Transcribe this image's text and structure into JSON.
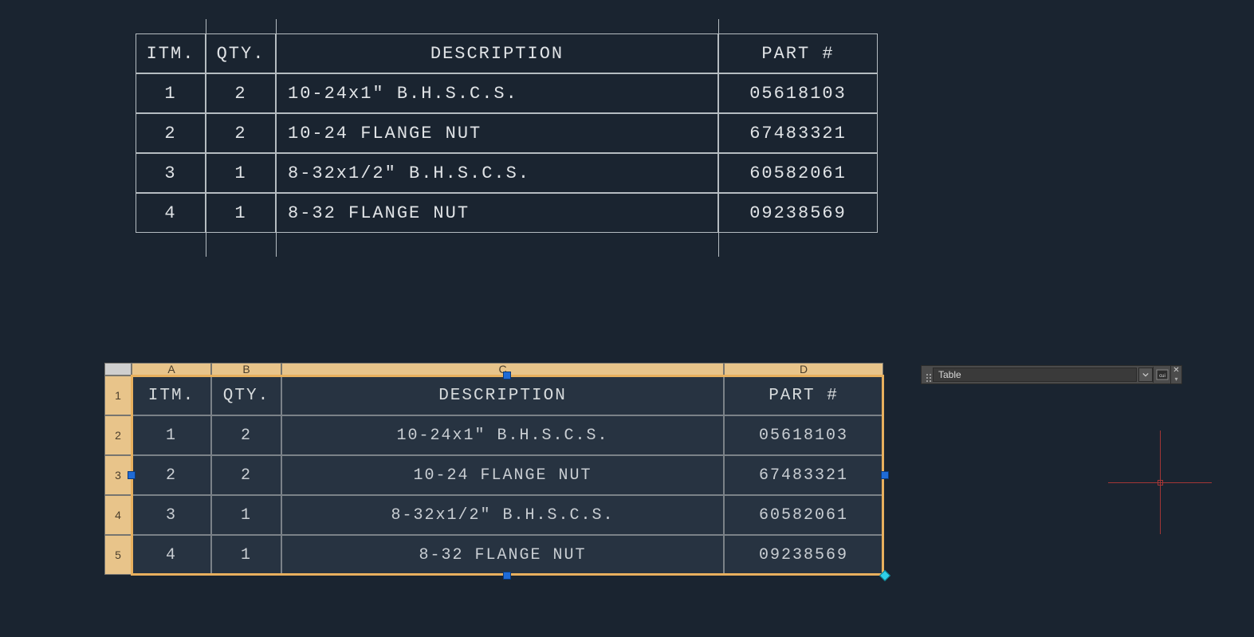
{
  "upper_table": {
    "headers": {
      "itm": "ITM.",
      "qty": "QTY.",
      "desc": "DESCRIPTION",
      "part": "PART #"
    },
    "rows": [
      {
        "itm": "1",
        "qty": "2",
        "desc": "10-24x1\" B.H.S.C.S.",
        "part": "05618103"
      },
      {
        "itm": "2",
        "qty": "2",
        "desc": "10-24 FLANGE NUT",
        "part": "67483321"
      },
      {
        "itm": "3",
        "qty": "1",
        "desc": "8-32x1/2\" B.H.S.C.S.",
        "part": "60582061"
      },
      {
        "itm": "4",
        "qty": "1",
        "desc": "8-32 FLANGE NUT",
        "part": "09238569"
      }
    ]
  },
  "lower_table": {
    "col_letters": [
      "A",
      "B",
      "C",
      "D"
    ],
    "row_numbers": [
      "1",
      "2",
      "3",
      "4",
      "5"
    ],
    "headers": {
      "itm": "ITM.",
      "qty": "QTY.",
      "desc": "DESCRIPTION",
      "part": "PART #"
    },
    "rows": [
      {
        "itm": "1",
        "qty": "2",
        "desc": "10-24x1\" B.H.S.C.S.",
        "part": "05618103"
      },
      {
        "itm": "2",
        "qty": "2",
        "desc": "10-24 FLANGE NUT",
        "part": "67483321"
      },
      {
        "itm": "3",
        "qty": "1",
        "desc": "8-32x1/2\" B.H.S.C.S.",
        "part": "60582061"
      },
      {
        "itm": "4",
        "qty": "1",
        "desc": "8-32 FLANGE NUT",
        "part": "09238569"
      }
    ]
  },
  "toolbar": {
    "label": "Table",
    "cui_label": "cui"
  }
}
